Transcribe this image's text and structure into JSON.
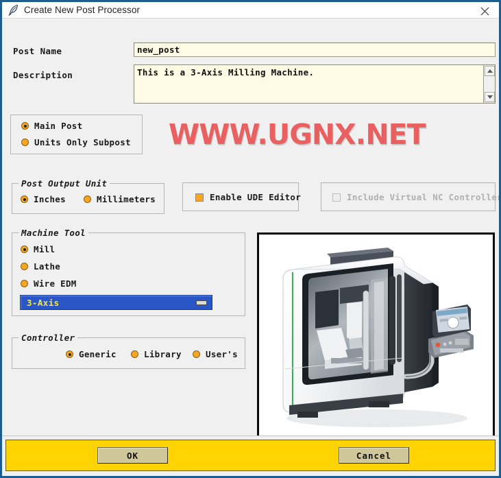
{
  "window": {
    "title": "Create New Post Processor",
    "title_icon": "feather-quill-icon",
    "close_icon": "close-icon"
  },
  "fields": {
    "post_name_label": "Post Name",
    "post_name_value": "new_post",
    "post_name_placeholder": "",
    "description_label": "Description",
    "description_value": "This is a 3-Axis Milling Machine.",
    "description_placeholder": ""
  },
  "post_type": {
    "options": [
      {
        "label": "Main Post",
        "selected": true
      },
      {
        "label": "Units Only Subpost",
        "selected": false
      }
    ]
  },
  "watermark": {
    "text": "WWW.UGNX.NET",
    "color": "#e8605f"
  },
  "post_output_unit": {
    "title": "Post Output Unit",
    "options": [
      {
        "label": "Inches",
        "selected": true
      },
      {
        "label": "Millimeters",
        "selected": false
      }
    ]
  },
  "ude": {
    "label": "Enable UDE Editor",
    "checked": true
  },
  "virtual_nc": {
    "label": "Include Virtual NC Controller",
    "checked": false,
    "disabled": true
  },
  "machine_tool": {
    "title": "Machine Tool",
    "options": [
      {
        "label": "Mill",
        "selected": true
      },
      {
        "label": "Lathe",
        "selected": false
      },
      {
        "label": "Wire EDM",
        "selected": false
      }
    ],
    "axis_dropdown": {
      "value": "3-Axis",
      "bg_color": "#2a56c6",
      "text_color": "#f5e642"
    }
  },
  "controller": {
    "title": "Controller",
    "options": [
      {
        "label": "Generic",
        "selected": true
      },
      {
        "label": "Library",
        "selected": false
      },
      {
        "label": "User's",
        "selected": false
      }
    ]
  },
  "preview_image": {
    "name": "cnc-milling-machine-photo"
  },
  "footer": {
    "bar_color": "#ffd400",
    "ok_label": "OK",
    "cancel_label": "Cancel"
  }
}
